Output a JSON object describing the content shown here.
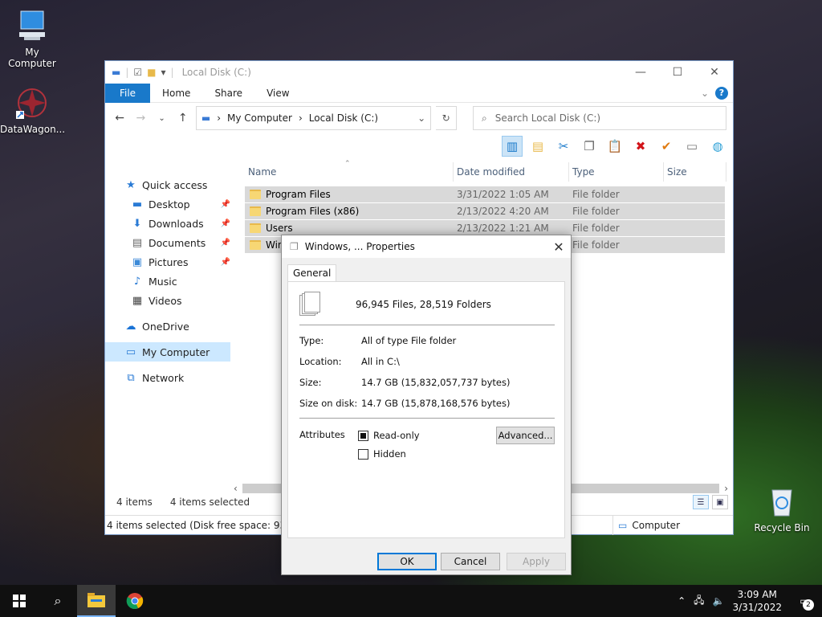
{
  "desktop": {
    "icons": [
      {
        "label": "My Computer",
        "icon": "computer-icon"
      },
      {
        "label": "DataWagon...",
        "icon": "datawagon-shortcut-icon"
      },
      {
        "label": "Recycle Bin",
        "icon": "recycle-bin-icon"
      }
    ]
  },
  "explorer": {
    "title": "Local Disk (C:)",
    "tabs": [
      "File",
      "Home",
      "Share",
      "View"
    ],
    "breadcrumb": [
      "My Computer",
      "Local Disk (C:)"
    ],
    "search_placeholder": "Search Local Disk (C:)",
    "columns": [
      "Name",
      "Date modified",
      "Type",
      "Size"
    ],
    "nav": {
      "quick_access": "Quick access",
      "items": [
        "Desktop",
        "Downloads",
        "Documents",
        "Pictures",
        "Music",
        "Videos"
      ],
      "onedrive": "OneDrive",
      "my_computer": "My Computer",
      "network": "Network"
    },
    "files": [
      {
        "name": "Program Files",
        "date": "3/31/2022 1:05 AM",
        "type": "File folder"
      },
      {
        "name": "Program Files (x86)",
        "date": "2/13/2022 4:20 AM",
        "type": "File folder"
      },
      {
        "name": "Users",
        "date": "2/13/2022 1:21 AM",
        "type": "File folder"
      },
      {
        "name": "Windows",
        "date": "",
        "type": "File folder"
      }
    ],
    "status": {
      "items": "4 items",
      "selected": "4 items selected",
      "detail": "4 items selected (Disk free space: 93.8 GB)",
      "location": "Computer"
    }
  },
  "dialog": {
    "title": "Windows, ... Properties",
    "tab": "General",
    "summary": "96,945 Files, 28,519 Folders",
    "props": [
      {
        "k": "Type:",
        "v": "All of type File folder"
      },
      {
        "k": "Location:",
        "v": "All in C:\\"
      },
      {
        "k": "Size:",
        "v": "14.7 GB (15,832,057,737 bytes)"
      },
      {
        "k": "Size on disk:",
        "v": "14.7 GB (15,878,168,576 bytes)"
      }
    ],
    "attributes_label": "Attributes",
    "readonly": "Read-only",
    "hidden": "Hidden",
    "advanced": "Advanced...",
    "ok": "OK",
    "cancel": "Cancel",
    "apply": "Apply"
  },
  "taskbar": {
    "time": "3:09 AM",
    "date": "3/31/2022",
    "notifications": "2"
  }
}
